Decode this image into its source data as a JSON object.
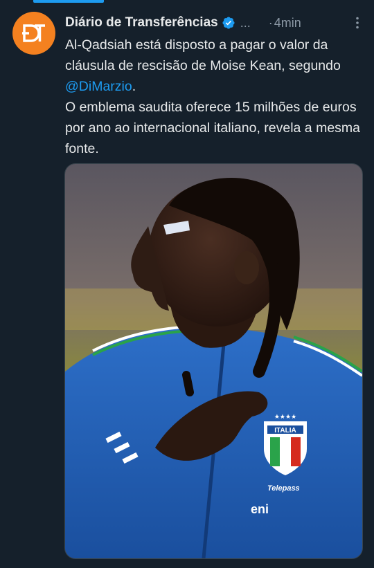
{
  "tweet": {
    "author": {
      "display_name": "Diário de Transferências",
      "verified": true,
      "handle": "...",
      "avatar_initials": "DT"
    },
    "time_separator": "·",
    "time": "4min",
    "text_lines": {
      "p1_pre": "Al-Qadsiah está disposto a pagar o valor da cláusula de rescisão de Moise Kean, segundo ",
      "mention": "@DiMarzio",
      "p1_post": ".",
      "p2": "O emblema saudita oferece 15 milhões de euros por ano ao internacional italiano, revela a mesma fonte."
    },
    "media": {
      "kind": "photo",
      "jersey_crest_text": "ITALIA",
      "sponsor_1": "Telepass",
      "sponsor_2": "eni"
    }
  },
  "colors": {
    "background": "#15202b",
    "accent": "#1d9bf0",
    "secondary_text": "#8b98a5",
    "avatar_bg": "#f48120",
    "jersey_blue": "#1f5fb4"
  },
  "icons": {
    "verified": "verified-badge-icon",
    "more": "more-vertical-icon"
  }
}
